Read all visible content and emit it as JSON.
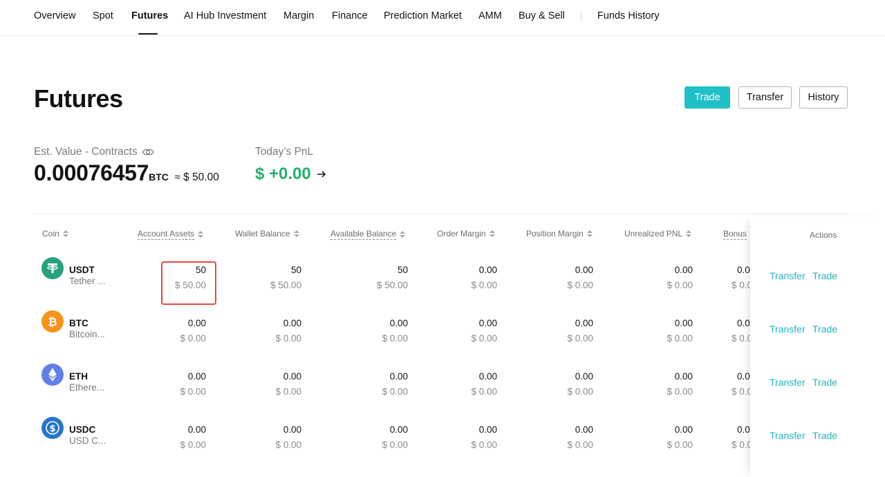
{
  "nav": {
    "items": [
      "Overview",
      "Spot",
      "Futures",
      "AI Hub Investment",
      "Margin",
      "Finance",
      "Prediction Market",
      "AMM",
      "Buy & Sell",
      "Funds History"
    ],
    "active": "Futures"
  },
  "page": {
    "title": "Futures",
    "buttons": {
      "trade": "Trade",
      "transfer": "Transfer",
      "history": "History"
    }
  },
  "summary": {
    "est_label": "Est. Value - Contracts",
    "est_value": "0.00076457",
    "est_unit": "BTC",
    "est_approx": "≈ $ 50.00",
    "pnl_label": "Today’s PnL",
    "pnl_value": "$ +0.00"
  },
  "table": {
    "headers": {
      "coin": "Coin",
      "account_assets": "Account Assets",
      "wallet_balance": "Wallet Balance",
      "available_balance": "Available Balance",
      "order_margin": "Order Margin",
      "position_margin": "Position Margin",
      "unrealized_pnl": "Unrealized PNL",
      "bonus": "Bonus",
      "actions": "Actions"
    },
    "rows": [
      {
        "symbol": "USDT",
        "name": "Tether ...",
        "account": [
          "50",
          "$ 50.00"
        ],
        "wallet": [
          "50",
          "$ 50.00"
        ],
        "available": [
          "50",
          "$ 50.00"
        ],
        "order": [
          "0.00",
          "$ 0.00"
        ],
        "position": [
          "0.00",
          "$ 0.00"
        ],
        "unrealized": [
          "0.00",
          "$ 0.00"
        ],
        "bonus": [
          "0.0",
          "$ 0.0"
        ]
      },
      {
        "symbol": "BTC",
        "name": "Bitcoin...",
        "account": [
          "0.00",
          "$ 0.00"
        ],
        "wallet": [
          "0.00",
          "$ 0.00"
        ],
        "available": [
          "0.00",
          "$ 0.00"
        ],
        "order": [
          "0.00",
          "$ 0.00"
        ],
        "position": [
          "0.00",
          "$ 0.00"
        ],
        "unrealized": [
          "0.00",
          "$ 0.00"
        ],
        "bonus": [
          "0.0",
          "$ 0.0"
        ]
      },
      {
        "symbol": "ETH",
        "name": "Ethere...",
        "account": [
          "0.00",
          "$ 0.00"
        ],
        "wallet": [
          "0.00",
          "$ 0.00"
        ],
        "available": [
          "0.00",
          "$ 0.00"
        ],
        "order": [
          "0.00",
          "$ 0.00"
        ],
        "position": [
          "0.00",
          "$ 0.00"
        ],
        "unrealized": [
          "0.00",
          "$ 0.00"
        ],
        "bonus": [
          "0.0",
          "$ 0.0"
        ]
      },
      {
        "symbol": "USDC",
        "name": "USD C...",
        "account": [
          "0.00",
          "$ 0.00"
        ],
        "wallet": [
          "0.00",
          "$ 0.00"
        ],
        "available": [
          "0.00",
          "$ 0.00"
        ],
        "order": [
          "0.00",
          "$ 0.00"
        ],
        "position": [
          "0.00",
          "$ 0.00"
        ],
        "unrealized": [
          "0.00",
          "$ 0.00"
        ],
        "bonus": [
          "0.0",
          "$ 0.0"
        ]
      }
    ],
    "action_labels": {
      "transfer": "Transfer",
      "trade": "Trade"
    }
  },
  "icons": {
    "usdt": "tether-icon",
    "btc": "bitcoin-icon",
    "eth": "ethereum-icon",
    "usdc": "usdc-icon",
    "visibility": "eye-icon",
    "pnl_arrow": "arrow-right-icon"
  },
  "colors": {
    "accent": "#1fc0c8",
    "positive": "#20b26c",
    "highlight": "#e5483f",
    "usdt": "#26a17b",
    "btc": "#f7931a",
    "eth": "#627eea",
    "usdc": "#2775ca"
  }
}
